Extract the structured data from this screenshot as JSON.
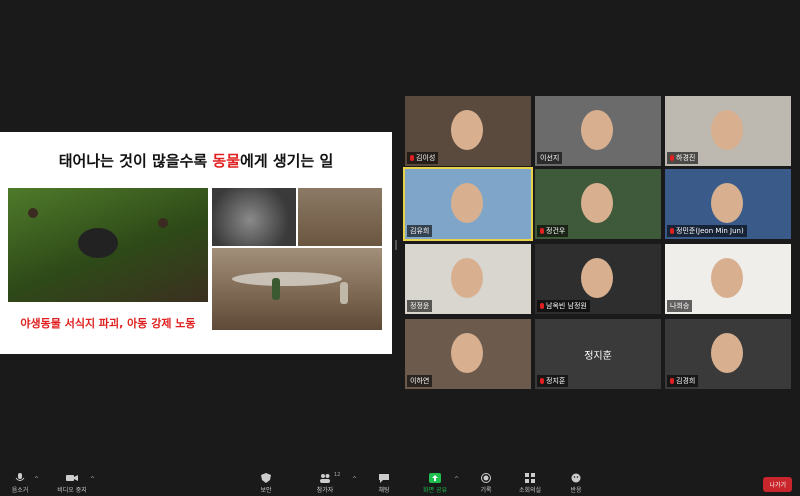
{
  "share": {
    "title_pre": "태어나는 것이 많을수록 ",
    "title_hl": "동물",
    "title_post": "에게 생기는 일",
    "caption": "야생동물 서식지 파괴, 아동 강제 노동"
  },
  "participants": [
    {
      "name": "김이성"
    },
    {
      "name": "이선지"
    },
    {
      "name": "하경진"
    },
    {
      "name": "김유희"
    },
    {
      "name": "정건우"
    },
    {
      "name": "정민준(Jeon Min Jun)"
    },
    {
      "name": "정정윤"
    },
    {
      "name": "남옥빈 남정원"
    },
    {
      "name": "나희승"
    },
    {
      "name": "이하연"
    },
    {
      "name": "정지훈"
    },
    {
      "name": "김경희"
    }
  ],
  "toolbar": {
    "audio": "음소거",
    "video": "비디오 중지",
    "security": "보안",
    "participants": "참가자",
    "participants_count": "12",
    "chat": "채팅",
    "share": "화면 공유",
    "record": "기록",
    "breakout": "소회의실",
    "reactions": "반응",
    "leave": "나가기"
  },
  "colors": {
    "share_accent": "#e02020",
    "active_speaker": "#e8d24a",
    "leave": "#c8262c",
    "share_button": "#1fbf4f"
  }
}
